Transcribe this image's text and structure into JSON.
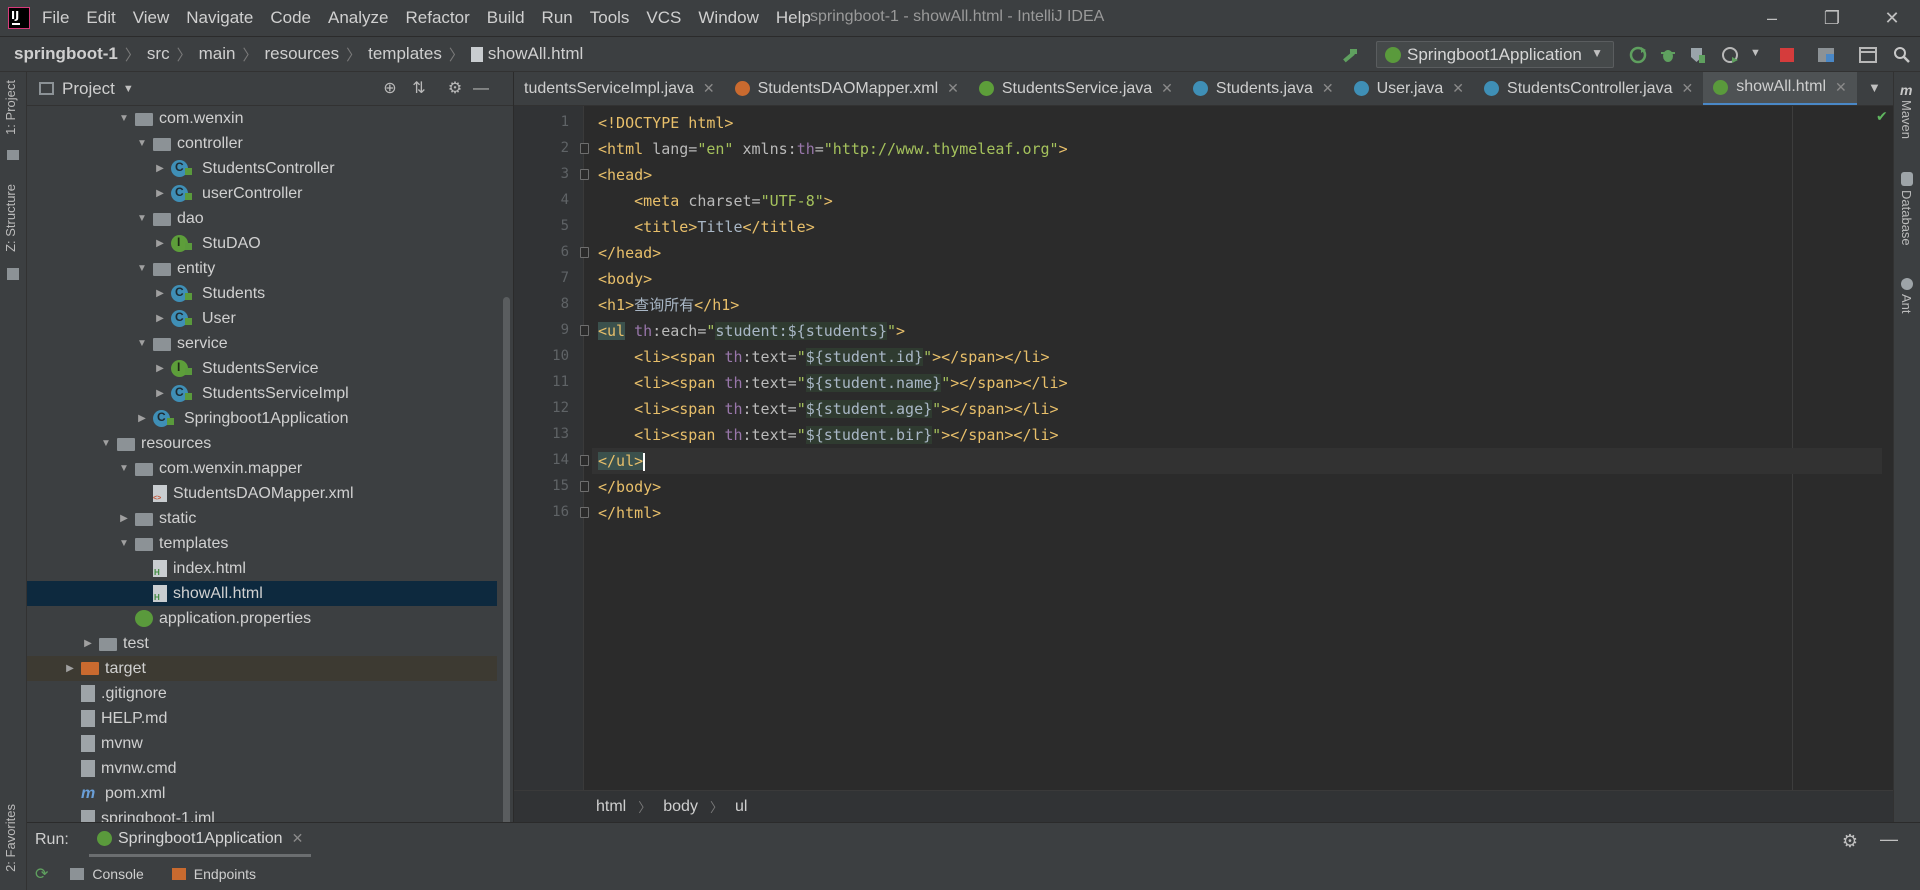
{
  "menu": [
    "File",
    "Edit",
    "View",
    "Navigate",
    "Code",
    "Analyze",
    "Refactor",
    "Build",
    "Run",
    "Tools",
    "VCS",
    "Window",
    "Help"
  ],
  "window_title": "springboot-1 - showAll.html - IntelliJ IDEA",
  "breadcrumb": [
    "springboot-1",
    "src",
    "main",
    "resources",
    "templates",
    "showAll.html"
  ],
  "run_config": "Springboot1Application",
  "left_tabs": [
    "1: Project",
    "Z: Structure",
    "2: Favorites"
  ],
  "right_tabs": [
    "Maven",
    "Database",
    "Ant"
  ],
  "project": {
    "title": "Project",
    "tree": [
      {
        "label": "com.wenxin",
        "indent": 5,
        "icon": "folder",
        "arrow": "down"
      },
      {
        "label": "controller",
        "indent": 6,
        "icon": "folder",
        "arrow": "down"
      },
      {
        "label": "StudentsController",
        "indent": 7,
        "icon": "class",
        "arrow": "right"
      },
      {
        "label": "userController",
        "indent": 7,
        "icon": "class",
        "arrow": "right"
      },
      {
        "label": "dao",
        "indent": 6,
        "icon": "folder",
        "arrow": "down"
      },
      {
        "label": "StuDAO",
        "indent": 7,
        "icon": "iface",
        "arrow": "right"
      },
      {
        "label": "entity",
        "indent": 6,
        "icon": "folder",
        "arrow": "down"
      },
      {
        "label": "Students",
        "indent": 7,
        "icon": "class",
        "arrow": "right"
      },
      {
        "label": "User",
        "indent": 7,
        "icon": "class",
        "arrow": "right"
      },
      {
        "label": "service",
        "indent": 6,
        "icon": "folder",
        "arrow": "down"
      },
      {
        "label": "StudentsService",
        "indent": 7,
        "icon": "iface",
        "arrow": "right"
      },
      {
        "label": "StudentsServiceImpl",
        "indent": 7,
        "icon": "class",
        "arrow": "right"
      },
      {
        "label": "Springboot1Application",
        "indent": 6,
        "icon": "class",
        "arrow": "right"
      },
      {
        "label": "resources",
        "indent": 4,
        "icon": "folder",
        "arrow": "down"
      },
      {
        "label": "com.wenxin.mapper",
        "indent": 5,
        "icon": "folder",
        "arrow": "down"
      },
      {
        "label": "StudentsDAOMapper.xml",
        "indent": 6,
        "icon": "file-x",
        "arrow": ""
      },
      {
        "label": "static",
        "indent": 5,
        "icon": "folder",
        "arrow": "right"
      },
      {
        "label": "templates",
        "indent": 5,
        "icon": "folder",
        "arrow": "down"
      },
      {
        "label": "index.html",
        "indent": 6,
        "icon": "file-h",
        "arrow": ""
      },
      {
        "label": "showAll.html",
        "indent": 6,
        "icon": "file-h",
        "arrow": "",
        "selected": true
      },
      {
        "label": "application.properties",
        "indent": 5,
        "icon": "leaf",
        "arrow": ""
      },
      {
        "label": "test",
        "indent": 3,
        "icon": "folder",
        "arrow": "right"
      },
      {
        "label": "target",
        "indent": 2,
        "icon": "folder-orange",
        "arrow": "right",
        "target": true
      },
      {
        "label": ".gitignore",
        "indent": 2,
        "icon": "file",
        "arrow": ""
      },
      {
        "label": "HELP.md",
        "indent": 2,
        "icon": "file",
        "arrow": ""
      },
      {
        "label": "mvnw",
        "indent": 2,
        "icon": "file",
        "arrow": ""
      },
      {
        "label": "mvnw.cmd",
        "indent": 2,
        "icon": "file",
        "arrow": ""
      },
      {
        "label": "pom.xml",
        "indent": 2,
        "icon": "maven",
        "arrow": ""
      },
      {
        "label": "springboot-1.iml",
        "indent": 2,
        "icon": "file",
        "arrow": ""
      }
    ]
  },
  "editor_tabs": [
    {
      "label": "tudentsServiceImpl.java",
      "icon_color": "",
      "active": false
    },
    {
      "label": "StudentsDAOMapper.xml",
      "icon_color": "#c96a2f",
      "active": false
    },
    {
      "label": "StudentsService.java",
      "icon_color": "#5d9e3a",
      "active": false
    },
    {
      "label": "Students.java",
      "icon_color": "#3f8fb6",
      "active": false
    },
    {
      "label": "User.java",
      "icon_color": "#3f8fb6",
      "active": false
    },
    {
      "label": "StudentsController.java",
      "icon_color": "#3f8fb6",
      "active": false
    },
    {
      "label": "showAll.html",
      "icon_color": "#5a9a3c",
      "active": true
    }
  ],
  "code_lines": [
    {
      "n": "1",
      "parts": [
        [
          "tg",
          "<!DOCTYPE html>"
        ]
      ]
    },
    {
      "n": "2",
      "parts": [
        [
          "tg",
          "<html "
        ],
        [
          "at",
          "lang="
        ],
        [
          "sv",
          "\"en\""
        ],
        [
          "at",
          " xmlns:"
        ],
        [
          "ns",
          "th"
        ],
        [
          "at",
          "="
        ],
        [
          "sv",
          "\"http://www.thymeleaf.org\""
        ],
        [
          "tg",
          ">"
        ]
      ]
    },
    {
      "n": "3",
      "parts": [
        [
          "tg",
          "<head>"
        ]
      ]
    },
    {
      "n": "4",
      "parts": [
        [
          "",
          "    "
        ],
        [
          "tg",
          "<meta "
        ],
        [
          "at",
          "charset="
        ],
        [
          "sv",
          "\"UTF-8\""
        ],
        [
          "tg",
          ">"
        ]
      ]
    },
    {
      "n": "5",
      "parts": [
        [
          "",
          "    "
        ],
        [
          "tg",
          "<title>"
        ],
        [
          "",
          "Title"
        ],
        [
          "tg",
          "</title>"
        ]
      ]
    },
    {
      "n": "6",
      "parts": [
        [
          "tg",
          "</head>"
        ]
      ]
    },
    {
      "n": "7",
      "parts": [
        [
          "tg",
          "<body>"
        ]
      ]
    },
    {
      "n": "8",
      "parts": [
        [
          "tg",
          "<h1>"
        ],
        [
          "",
          "查询所有"
        ],
        [
          "tg",
          "</h1>"
        ]
      ]
    },
    {
      "n": "9",
      "parts": [
        [
          "br",
          "<ul"
        ],
        [
          "ns",
          " th"
        ],
        [
          "at",
          ":each="
        ],
        [
          "sv",
          "\""
        ],
        [
          "ex",
          "student:${students}"
        ],
        [
          "sv",
          "\""
        ],
        [
          "tg",
          ">"
        ]
      ]
    },
    {
      "n": "10",
      "parts": [
        [
          "",
          "    "
        ],
        [
          "tg",
          "<li><span "
        ],
        [
          "ns",
          "th"
        ],
        [
          "at",
          ":text="
        ],
        [
          "sv",
          "\""
        ],
        [
          "ex",
          "${student.id}"
        ],
        [
          "sv",
          "\""
        ],
        [
          "tg",
          "></span></li>"
        ]
      ]
    },
    {
      "n": "11",
      "parts": [
        [
          "",
          "    "
        ],
        [
          "tg",
          "<li><span "
        ],
        [
          "ns",
          "th"
        ],
        [
          "at",
          ":text="
        ],
        [
          "sv",
          "\""
        ],
        [
          "ex",
          "${student.name}"
        ],
        [
          "sv",
          "\""
        ],
        [
          "tg",
          "></span></li>"
        ]
      ]
    },
    {
      "n": "12",
      "parts": [
        [
          "",
          "    "
        ],
        [
          "tg",
          "<li><span "
        ],
        [
          "ns",
          "th"
        ],
        [
          "at",
          ":text="
        ],
        [
          "sv",
          "\""
        ],
        [
          "ex",
          "${student.age}"
        ],
        [
          "sv",
          "\""
        ],
        [
          "tg",
          "></span></li>"
        ]
      ]
    },
    {
      "n": "13",
      "parts": [
        [
          "",
          "    "
        ],
        [
          "tg",
          "<li><span "
        ],
        [
          "ns",
          "th"
        ],
        [
          "at",
          ":text="
        ],
        [
          "sv",
          "\""
        ],
        [
          "ex",
          "${student.bir}"
        ],
        [
          "sv",
          "\""
        ],
        [
          "tg",
          "></span></li>"
        ]
      ]
    },
    {
      "n": "14",
      "parts": [
        [
          "br",
          "</ul>"
        ]
      ],
      "current": true
    },
    {
      "n": "15",
      "parts": [
        [
          "tg",
          "</body>"
        ]
      ]
    },
    {
      "n": "16",
      "parts": [
        [
          "tg",
          "</html>"
        ]
      ]
    }
  ],
  "editor_breadcrumb": [
    "html",
    "body",
    "ul"
  ],
  "run": {
    "label": "Run:",
    "tab": "Springboot1Application",
    "sub_tabs": [
      "Console",
      "Endpoints"
    ]
  },
  "colors": {
    "accent": "#4a88c7",
    "selection": "#0d293e",
    "tag": "#e8bf6a",
    "string": "#a5c25c"
  }
}
